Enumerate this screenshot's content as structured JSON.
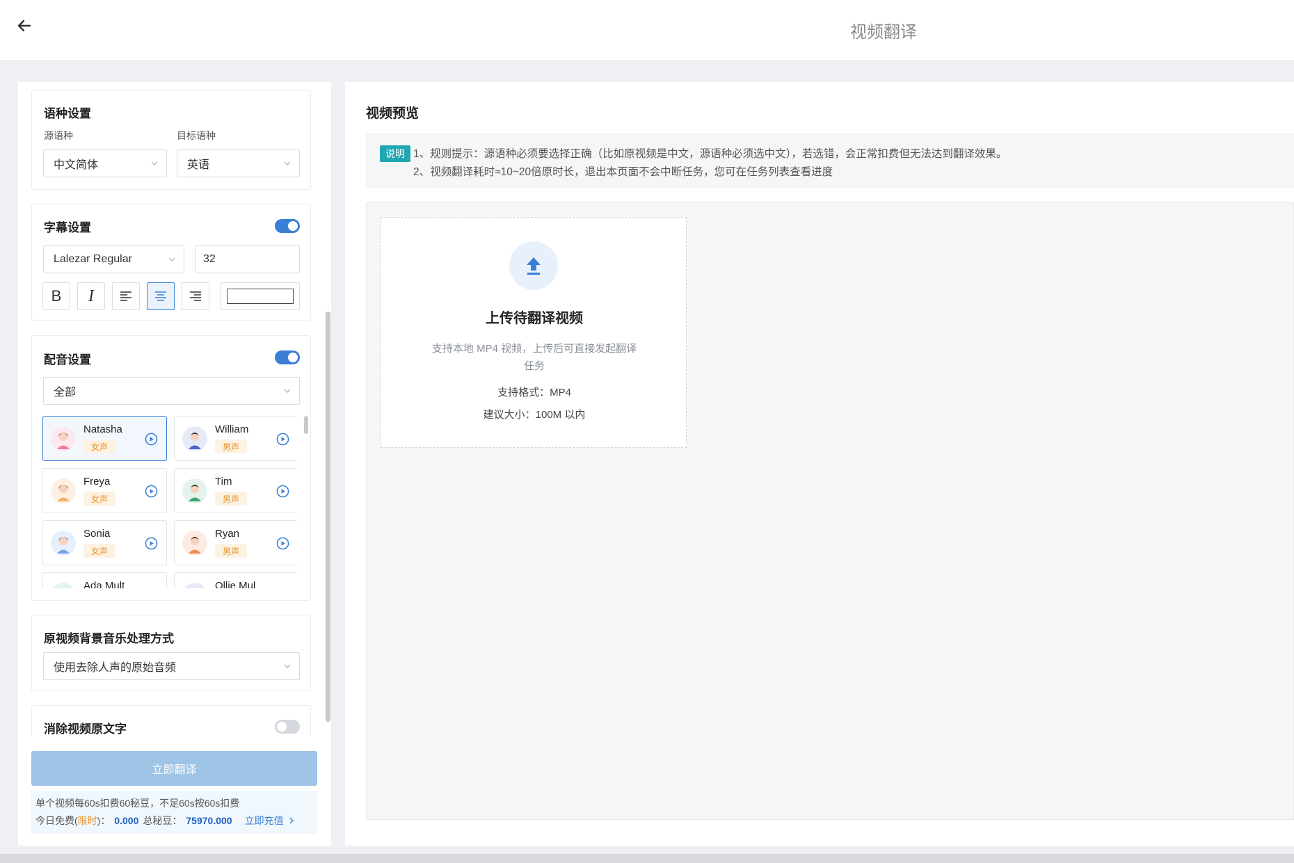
{
  "header": {
    "title": "视频翻译",
    "back_icon": "arrow-left-icon"
  },
  "language": {
    "title": "语种设置",
    "source_label": "源语种",
    "source_value": "中文简体",
    "target_label": "目标语种",
    "target_value": "英语"
  },
  "subtitle": {
    "title": "字幕设置",
    "enabled": true,
    "font": "Lalezar Regular",
    "size": "32",
    "bold_glyph": "B",
    "italic_glyph": "I",
    "alignment": "center",
    "color": "#ffffff"
  },
  "dubbing": {
    "title": "配音设置",
    "enabled": true,
    "filter": "全部",
    "selected": "Natasha",
    "voices": [
      {
        "name": "Natasha",
        "tag": "女声"
      },
      {
        "name": "William",
        "tag": "男声"
      },
      {
        "name": "Freya",
        "tag": "女声"
      },
      {
        "name": "Tim",
        "tag": "男声"
      },
      {
        "name": "Sonia",
        "tag": "女声"
      },
      {
        "name": "Ryan",
        "tag": "男声"
      },
      {
        "name": "Ada Mult",
        "tag": ""
      },
      {
        "name": "Ollie Mul",
        "tag": ""
      }
    ]
  },
  "bgm": {
    "title": "原视频背景音乐处理方式",
    "value": "使用去除人声的原始音频"
  },
  "erase_text": {
    "title": "消除视频原文字",
    "enabled": false
  },
  "submit": {
    "label": "立即翻译"
  },
  "cost": {
    "line1": "单个视频每60s扣费60秘豆，不足60s按60s扣费",
    "free_label_a": "今日免费(",
    "free_label_limited": "限时",
    "free_label_b": ")：",
    "free_value": "0.000",
    "total_label": "总秘豆：",
    "total_value": "75970.000",
    "recharge_label": "立即充值"
  },
  "preview": {
    "title": "视频预览",
    "notice_badge": "说明",
    "notice_line1": "1、规则提示：源语种必须要选择正确（比如原视频是中文，源语种必须选中文），若选错，会正常扣费但无法达到翻译效果。",
    "notice_line2": "2、视频翻译耗时≈10~20倍原时长，退出本页面不会中断任务，您可在任务列表查看进度",
    "upload_title": "上传待翻译视频",
    "upload_desc_1": "支持本地 MP4 视频，上传后可直接发起翻译",
    "upload_desc_2": "任务",
    "upload_format": "支持格式：MP4",
    "upload_size": "建议大小：100M 以内"
  }
}
